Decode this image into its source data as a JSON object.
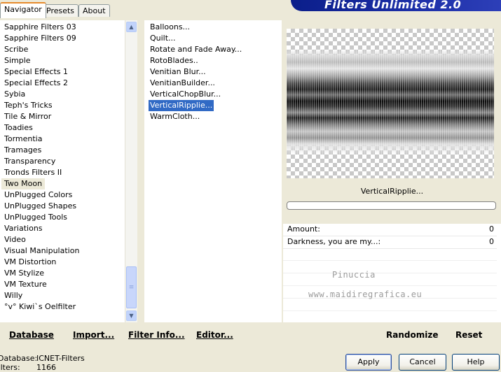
{
  "tabs": [
    {
      "label": "Navigator"
    },
    {
      "label": "Presets"
    },
    {
      "label": "About"
    }
  ],
  "app_title": "Filters Unlimited 2.0",
  "categories": [
    "Sapphire Filters 03",
    "Sapphire Filters 09",
    "Scribe",
    "Simple",
    "Special Effects 1",
    "Special Effects 2",
    "Sybia",
    "Teph's Tricks",
    "Tile & Mirror",
    "Toadies",
    "Tormentia",
    "Tramages",
    "Transparency",
    "Tronds Filters II",
    "Two Moon",
    "UnPlugged Colors",
    "UnPlugged Shapes",
    "UnPlugged Tools",
    "Variations",
    "Video",
    "Visual Manipulation",
    "VM Distortion",
    "VM Stylize",
    "VM Texture",
    "Willy",
    "°v° Kiwi`s Oelfilter"
  ],
  "selected_category": "Two Moon",
  "filters": [
    "Balloons...",
    "Quilt...",
    "Rotate and Fade Away...",
    "RotoBlades..",
    "Venitian Blur...",
    "VenitianBuilder...",
    "VerticalChopBlur...",
    "VerticalRipplie...",
    "WarmCloth..."
  ],
  "selected_filter": "VerticalRipplie...",
  "preview": {
    "filter_name": "VerticalRipplie...",
    "progress_percent": 0
  },
  "params": [
    {
      "label": "Amount:",
      "value": "0"
    },
    {
      "label": "Darkness, you are my...:",
      "value": "0"
    }
  ],
  "watermark": {
    "line1": "Pinuccia",
    "line2": "www.maidiregrafica.eu"
  },
  "bottom_links": {
    "database": "Database",
    "import": "Import...",
    "filter_info": "Filter Info...",
    "editor": "Editor...",
    "randomize": "Randomize",
    "reset": "Reset"
  },
  "status": {
    "database_label": "Database:",
    "database_value": "ICNET-Filters",
    "filters_label": "Filters:",
    "filters_value": "1166"
  },
  "buttons": {
    "apply": "Apply",
    "cancel": "Cancel",
    "help": "Help"
  },
  "icons": {
    "scroll_up": "▲",
    "scroll_down": "▼",
    "grip": "≡"
  }
}
